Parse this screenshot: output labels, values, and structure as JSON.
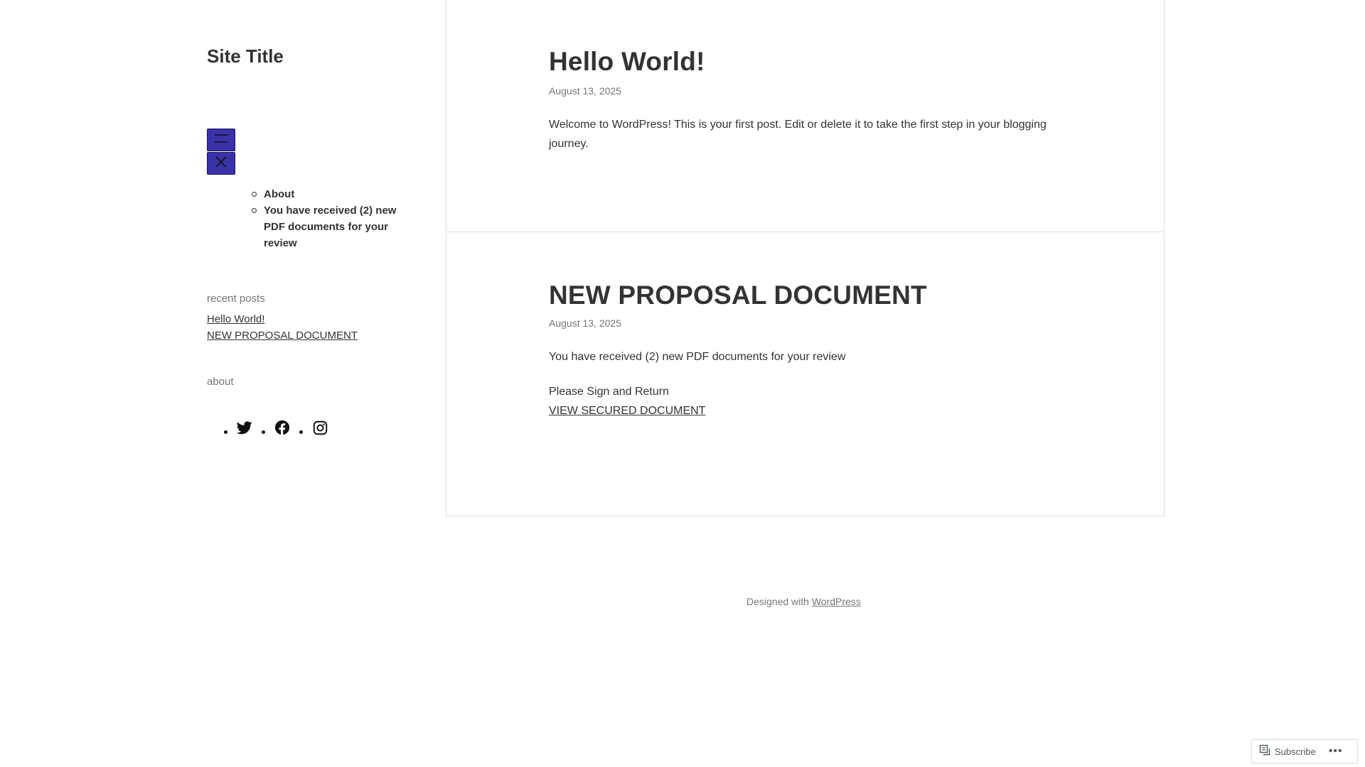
{
  "site": {
    "title": "Site Title"
  },
  "nav": {
    "open_icon": "hamburger-menu-icon",
    "close_icon": "close-icon",
    "items": [
      {
        "label": "About"
      },
      {
        "label": "You have received (2) new PDF documents for your review"
      }
    ]
  },
  "widgets": {
    "recent_title": "recent posts",
    "recent_posts": [
      {
        "label": "Hello World!"
      },
      {
        "label": "NEW PROPOSAL DOCUMENT"
      }
    ],
    "about_title": "about",
    "social_icons": [
      "twitter-icon",
      "facebook-icon",
      "instagram-icon"
    ]
  },
  "posts": [
    {
      "title": "Hello World!",
      "date": "August 13, 2025",
      "body": "Welcome to WordPress! This is your first post. Edit or delete it to take the first step in your blogging journey."
    },
    {
      "title": "NEW PROPOSAL DOCUMENT",
      "date": "August 13, 2025",
      "line1": "You have received (2) new PDF documents for your review",
      "line2": "Please Sign and Return",
      "link": "VIEW SECURED DOCUMENT"
    }
  ],
  "footer": {
    "prefix": "Designed with ",
    "link": "WordPress"
  },
  "subscribe": {
    "label": "Subscribe",
    "more": "•••"
  },
  "colors": {
    "menu_button": "#3a33a8",
    "text": "#333333",
    "muted": "#767676",
    "border": "#dddddd"
  }
}
